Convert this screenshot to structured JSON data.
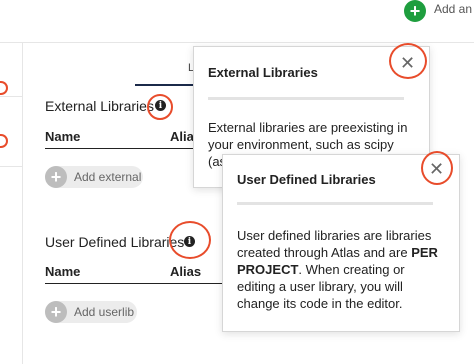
{
  "header": {
    "add_label": "Add an e"
  },
  "tabs": {
    "partial_label": "L"
  },
  "external": {
    "title": "External Libraries",
    "col_name": "Name",
    "col_alias": "Alias",
    "add_label": "Add external"
  },
  "userdef": {
    "title": "User Defined Libraries",
    "col_name": "Name",
    "col_alias": "Alias",
    "add_label": "Add userlib"
  },
  "popover_external": {
    "title": "External Libraries",
    "body_line1": "External libraries are preexisting in",
    "body_line2": "your environment, such as scipy",
    "body_line3": "(as"
  },
  "popover_userdef": {
    "title": "User Defined Libraries",
    "body_line1": "User defined libraries are libraries",
    "body_line2_pre": "created through Atlas and are ",
    "body_line2_bold": "PER",
    "body_line3_bold": "PROJECT",
    "body_line3_post": ". When creating or",
    "body_line4": "editing a user library, you will",
    "body_line5": "change its code in the editor."
  },
  "colors": {
    "accent_red": "#e84c2b",
    "add_green": "#1e9e3e",
    "tab_underline": "#1b2a4a"
  },
  "icons": [
    "add-icon",
    "info-icon",
    "close-icon"
  ]
}
